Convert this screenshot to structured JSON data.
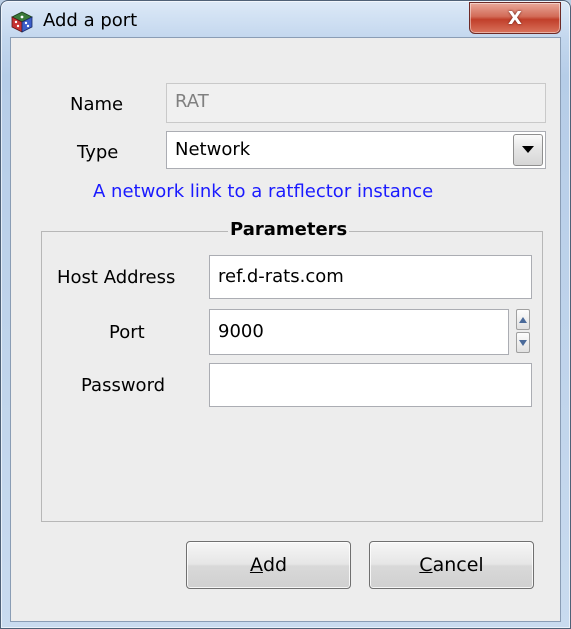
{
  "window": {
    "title": "Add a port",
    "close_glyph": "X",
    "app_icon": "dice-cube-icon"
  },
  "form": {
    "name_label": "Name",
    "name_value": "RAT",
    "type_label": "Type",
    "type_value": "Network",
    "type_description": "A network link to a ratflector instance"
  },
  "parameters": {
    "title": "Parameters",
    "host_label": "Host Address",
    "host_value": "ref.d-rats.com",
    "port_label": "Port",
    "port_value": "9000",
    "password_label": "Password",
    "password_value": ""
  },
  "buttons": {
    "add_mnemonic": "A",
    "add_rest": "dd",
    "cancel_mnemonic": "C",
    "cancel_rest": "ancel"
  },
  "colors": {
    "description_text": "#1a1aff",
    "close_button": "#c13f2a"
  }
}
